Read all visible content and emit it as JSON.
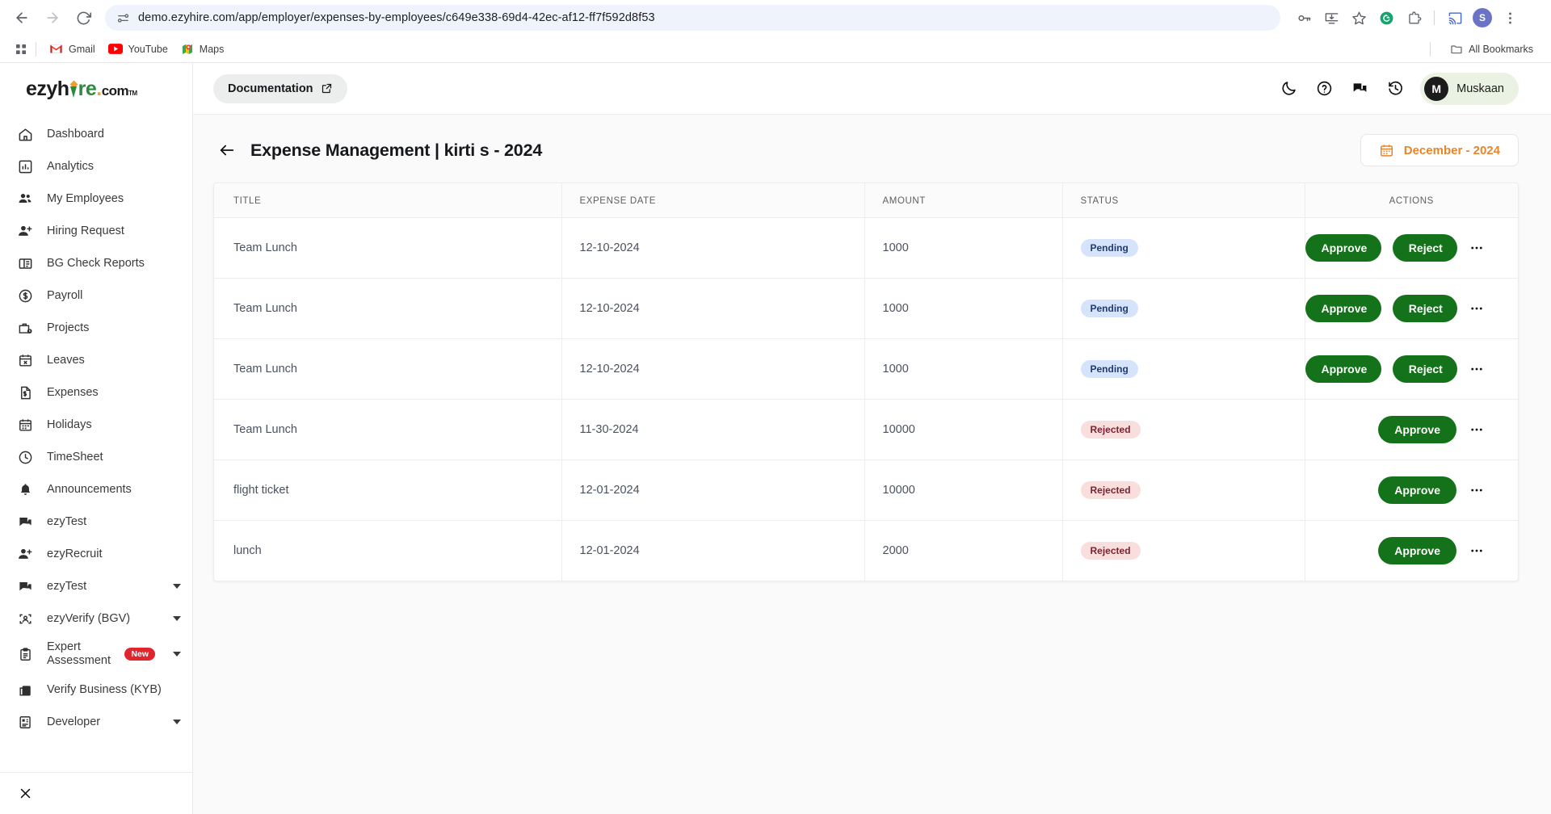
{
  "browser": {
    "url": "demo.ezyhire.com/app/employer/expenses-by-employees/c649e338-69d4-42ec-af12-ff7f592d8f53",
    "nav": {
      "back": "back-arrow",
      "forward": "forward-arrow",
      "reload": "reload"
    },
    "toolbar_icons": [
      "password-key-icon",
      "install-app-icon",
      "bookmark-star-icon",
      "grammarly-icon",
      "extensions-icon",
      "cast-icon",
      "profile-avatar",
      "chrome-menu-icon"
    ],
    "profile_initial": "S",
    "bookmarks": [
      {
        "label": "Gmail",
        "icon": "gmail-icon"
      },
      {
        "label": "YouTube",
        "icon": "youtube-icon"
      },
      {
        "label": "Maps",
        "icon": "maps-icon"
      }
    ],
    "all_bookmarks_label": "All Bookmarks"
  },
  "sidebar": {
    "logo": {
      "part1": "ezyh",
      "part2": "r",
      "part3": "e",
      "dot": ".",
      "dotcom": "com",
      "tm": "TM"
    },
    "items": [
      {
        "label": "Dashboard",
        "icon": "home-icon",
        "caret": false,
        "badge": null
      },
      {
        "label": "Analytics",
        "icon": "analytics-icon",
        "caret": false,
        "badge": null
      },
      {
        "label": "My Employees",
        "icon": "people-icon",
        "caret": false,
        "badge": null
      },
      {
        "label": "Hiring Request",
        "icon": "person-add-icon",
        "caret": false,
        "badge": null
      },
      {
        "label": "BG Check Reports",
        "icon": "report-icon",
        "caret": false,
        "badge": null
      },
      {
        "label": "Payroll",
        "icon": "dollar-circle-icon",
        "caret": false,
        "badge": null
      },
      {
        "label": "Projects",
        "icon": "briefcase-clock-icon",
        "caret": false,
        "badge": null
      },
      {
        "label": "Leaves",
        "icon": "calendar-x-icon",
        "caret": false,
        "badge": null
      },
      {
        "label": "Expenses",
        "icon": "expense-doc-icon",
        "caret": false,
        "badge": null
      },
      {
        "label": "Holidays",
        "icon": "calendar-icon",
        "caret": false,
        "badge": null
      },
      {
        "label": "TimeSheet",
        "icon": "clock-icon",
        "caret": false,
        "badge": null
      },
      {
        "label": "Announcements",
        "icon": "bell-icon",
        "caret": false,
        "badge": null
      },
      {
        "label": "ezyTest",
        "icon": "chat-icon",
        "caret": false,
        "badge": null
      },
      {
        "label": "ezyRecruit",
        "icon": "person-add-icon",
        "caret": false,
        "badge": null
      },
      {
        "label": "ezyTest",
        "icon": "chat-icon",
        "caret": true,
        "badge": null
      },
      {
        "label": "ezyVerify (BGV)",
        "icon": "face-scan-icon",
        "caret": true,
        "badge": null
      },
      {
        "label": "Expert Assessment",
        "icon": "clipboard-icon",
        "caret": true,
        "badge": "New"
      },
      {
        "label": "Verify Business (KYB)",
        "icon": "business-icon",
        "caret": false,
        "badge": null
      },
      {
        "label": "Developer",
        "icon": "developer-icon",
        "caret": true,
        "badge": null
      }
    ],
    "close_icon": "close-icon"
  },
  "topbar": {
    "documentation_label": "Documentation",
    "documentation_icon": "external-link-icon",
    "icons": [
      "dark-mode-icon",
      "help-icon",
      "chat-icon",
      "history-icon"
    ],
    "user": {
      "initial": "M",
      "name": "Muskaan"
    }
  },
  "page": {
    "back_icon": "back-arrow-icon",
    "title": "Expense Management | kirti s - 2024",
    "date_filter": {
      "label": "December - 2024",
      "icon": "calendar-icon"
    }
  },
  "table": {
    "columns": [
      "TITLE",
      "EXPENSE DATE",
      "AMOUNT",
      "STATUS",
      "ACTIONS"
    ],
    "rows": [
      {
        "title": "Team Lunch",
        "date": "12-10-2024",
        "amount": "1000",
        "status": "Pending",
        "status_type": "pending",
        "actions": [
          "Approve",
          "Reject"
        ]
      },
      {
        "title": "Team Lunch",
        "date": "12-10-2024",
        "amount": "1000",
        "status": "Pending",
        "status_type": "pending",
        "actions": [
          "Approve",
          "Reject"
        ]
      },
      {
        "title": "Team Lunch",
        "date": "12-10-2024",
        "amount": "1000",
        "status": "Pending",
        "status_type": "pending",
        "actions": [
          "Approve",
          "Reject"
        ]
      },
      {
        "title": "Team Lunch",
        "date": "11-30-2024",
        "amount": "10000",
        "status": "Rejected",
        "status_type": "rejected",
        "actions": [
          "Approve"
        ]
      },
      {
        "title": "flight ticket",
        "date": "12-01-2024",
        "amount": "10000",
        "status": "Rejected",
        "status_type": "rejected",
        "actions": [
          "Approve"
        ]
      },
      {
        "title": "lunch",
        "date": "12-01-2024",
        "amount": "2000",
        "status": "Rejected",
        "status_type": "rejected",
        "actions": [
          "Approve"
        ]
      }
    ],
    "more_icon": "kebab-menu-icon"
  },
  "colors": {
    "accent_green": "#14731a",
    "accent_orange": "#e8852b",
    "badge_new": "#e0252f",
    "pending_bg": "#d6e4fb",
    "rejected_bg": "#f9dede"
  }
}
